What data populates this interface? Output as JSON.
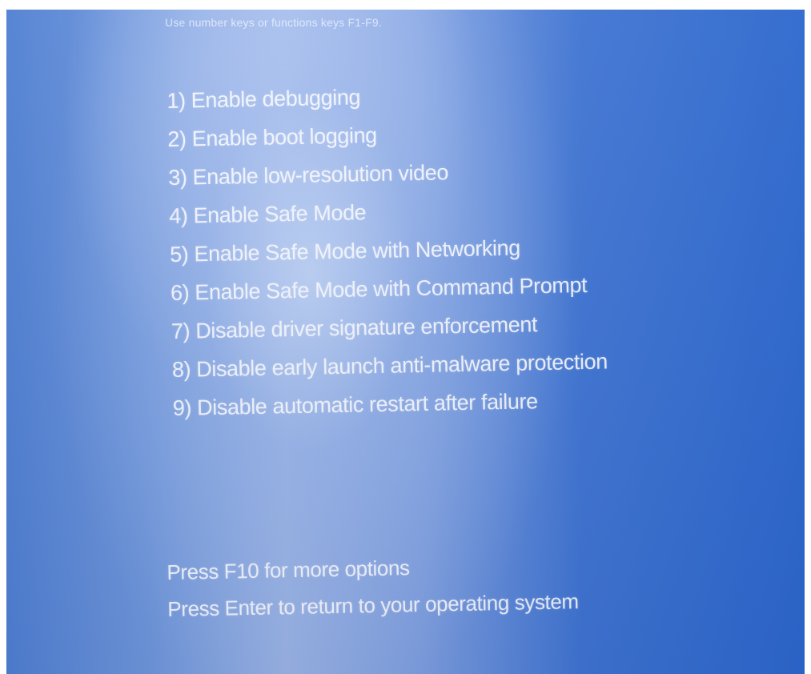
{
  "screen": {
    "hint": "Use number keys or functions keys F1-F9.",
    "options": [
      "1) Enable debugging",
      "2) Enable boot logging",
      "3) Enable low-resolution video",
      "4) Enable Safe Mode",
      "5) Enable Safe Mode with Networking",
      "6) Enable Safe Mode with Command Prompt",
      "7) Disable driver signature enforcement",
      "8) Disable early launch anti-malware protection",
      "9) Disable automatic restart after failure"
    ],
    "footer": {
      "more_options": "Press F10 for more options",
      "return": "Press Enter to return to your operating system"
    }
  },
  "colors": {
    "background_blue": "#2c67cd",
    "text": "#f6f9ff"
  }
}
